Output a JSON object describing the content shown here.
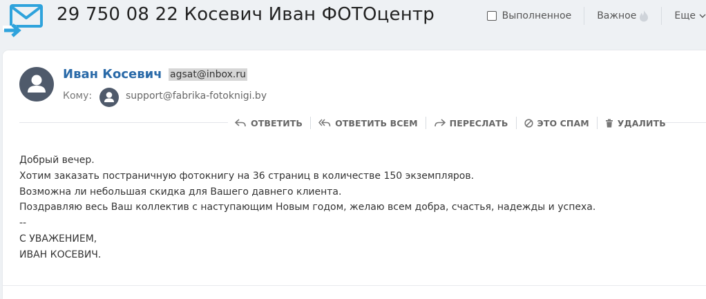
{
  "header": {
    "subject": "29 750 08 22 Косевич Иван ФОТОцентр",
    "done_label": "Выполненное",
    "important_label": "Важное",
    "more_label": "Еще",
    "accent_color": "#2fa3dc"
  },
  "message": {
    "sender_name": "Иван Косевич",
    "sender_email": "agsat@inbox.ru",
    "to_label": "Кому:",
    "to_email": "support@fabrika-fotoknigi.by",
    "sender_color": "#2a6aa8"
  },
  "actions": {
    "reply": "ОТВЕТИТЬ",
    "reply_all": "ОТВЕТИТЬ ВСЕМ",
    "forward": "ПЕРЕСЛАТЬ",
    "spam": "ЭТО СПАМ",
    "delete": "УДАЛИТЬ"
  },
  "body": {
    "lines": [
      "Добрый вечер.",
      "Хотим заказать постраничную фотокнигу на 36 страниц в количестве 150 экземпляров.",
      "Возможна ли небольшая скидка для Вашего давнего клиента.",
      "Поздравляю весь Ваш коллектив с наступающим Новым годом, желаю всем добра, счастья, надежды и успеха.",
      "--",
      "С УВАЖЕНИЕМ,",
      "ИВАН КОСЕВИЧ."
    ]
  },
  "icons": {
    "logo": "incoming-mail-icon",
    "important": "flame-icon",
    "more": "chevron-down-icon",
    "reply": "reply-icon",
    "reply_all": "reply-all-icon",
    "forward": "forward-icon",
    "spam": "spam-icon",
    "delete": "trash-icon",
    "avatar": "user-avatar-icon"
  }
}
